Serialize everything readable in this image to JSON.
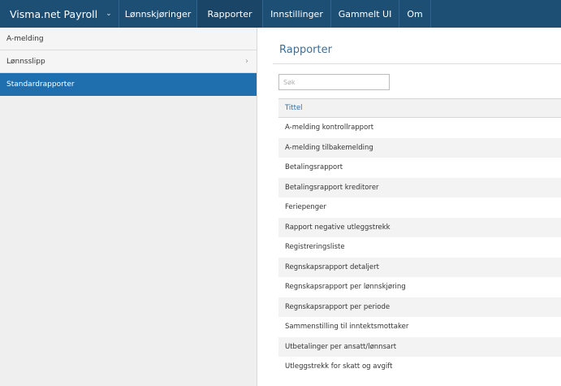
{
  "topnav": {
    "brand": "Visma.net Payroll",
    "items": [
      {
        "label": "Lønnskjøringer"
      },
      {
        "label": "Rapporter"
      },
      {
        "label": "Innstillinger"
      },
      {
        "label": "Gammelt UI"
      },
      {
        "label": "Om"
      }
    ],
    "active": "Rapporter"
  },
  "sidebar": {
    "items": [
      {
        "label": "A-melding"
      },
      {
        "label": "Lønnsslipp"
      },
      {
        "label": "Standardrapporter"
      }
    ],
    "active": "Standardrapporter"
  },
  "main": {
    "title": "Rapporter",
    "search": {
      "placeholder": "Søk",
      "value": ""
    },
    "table": {
      "header": "Tittel",
      "rows": [
        "A-melding kontrollrapport",
        "A-melding tilbakemelding",
        "Betalingsrapport",
        "Betalingsrapport kreditorer",
        "Feriepenger",
        "Rapport negative utleggstrekk",
        "Registreringsliste",
        "Regnskapsrapport detaljert",
        "Regnskapsrapport per lønnskjøring",
        "Regnskapsrapport per periode",
        "Sammenstilling til inntektsmottaker",
        "Utbetalinger per ansatt/lønnsart",
        "Utleggstrekk for skatt og avgift"
      ]
    }
  },
  "colors": {
    "nav_bg": "#1d4e73",
    "nav_active": "#1a4566",
    "sidebar_active": "#1f6fae",
    "title": "#3e6e96",
    "header_text": "#2d6da5"
  }
}
